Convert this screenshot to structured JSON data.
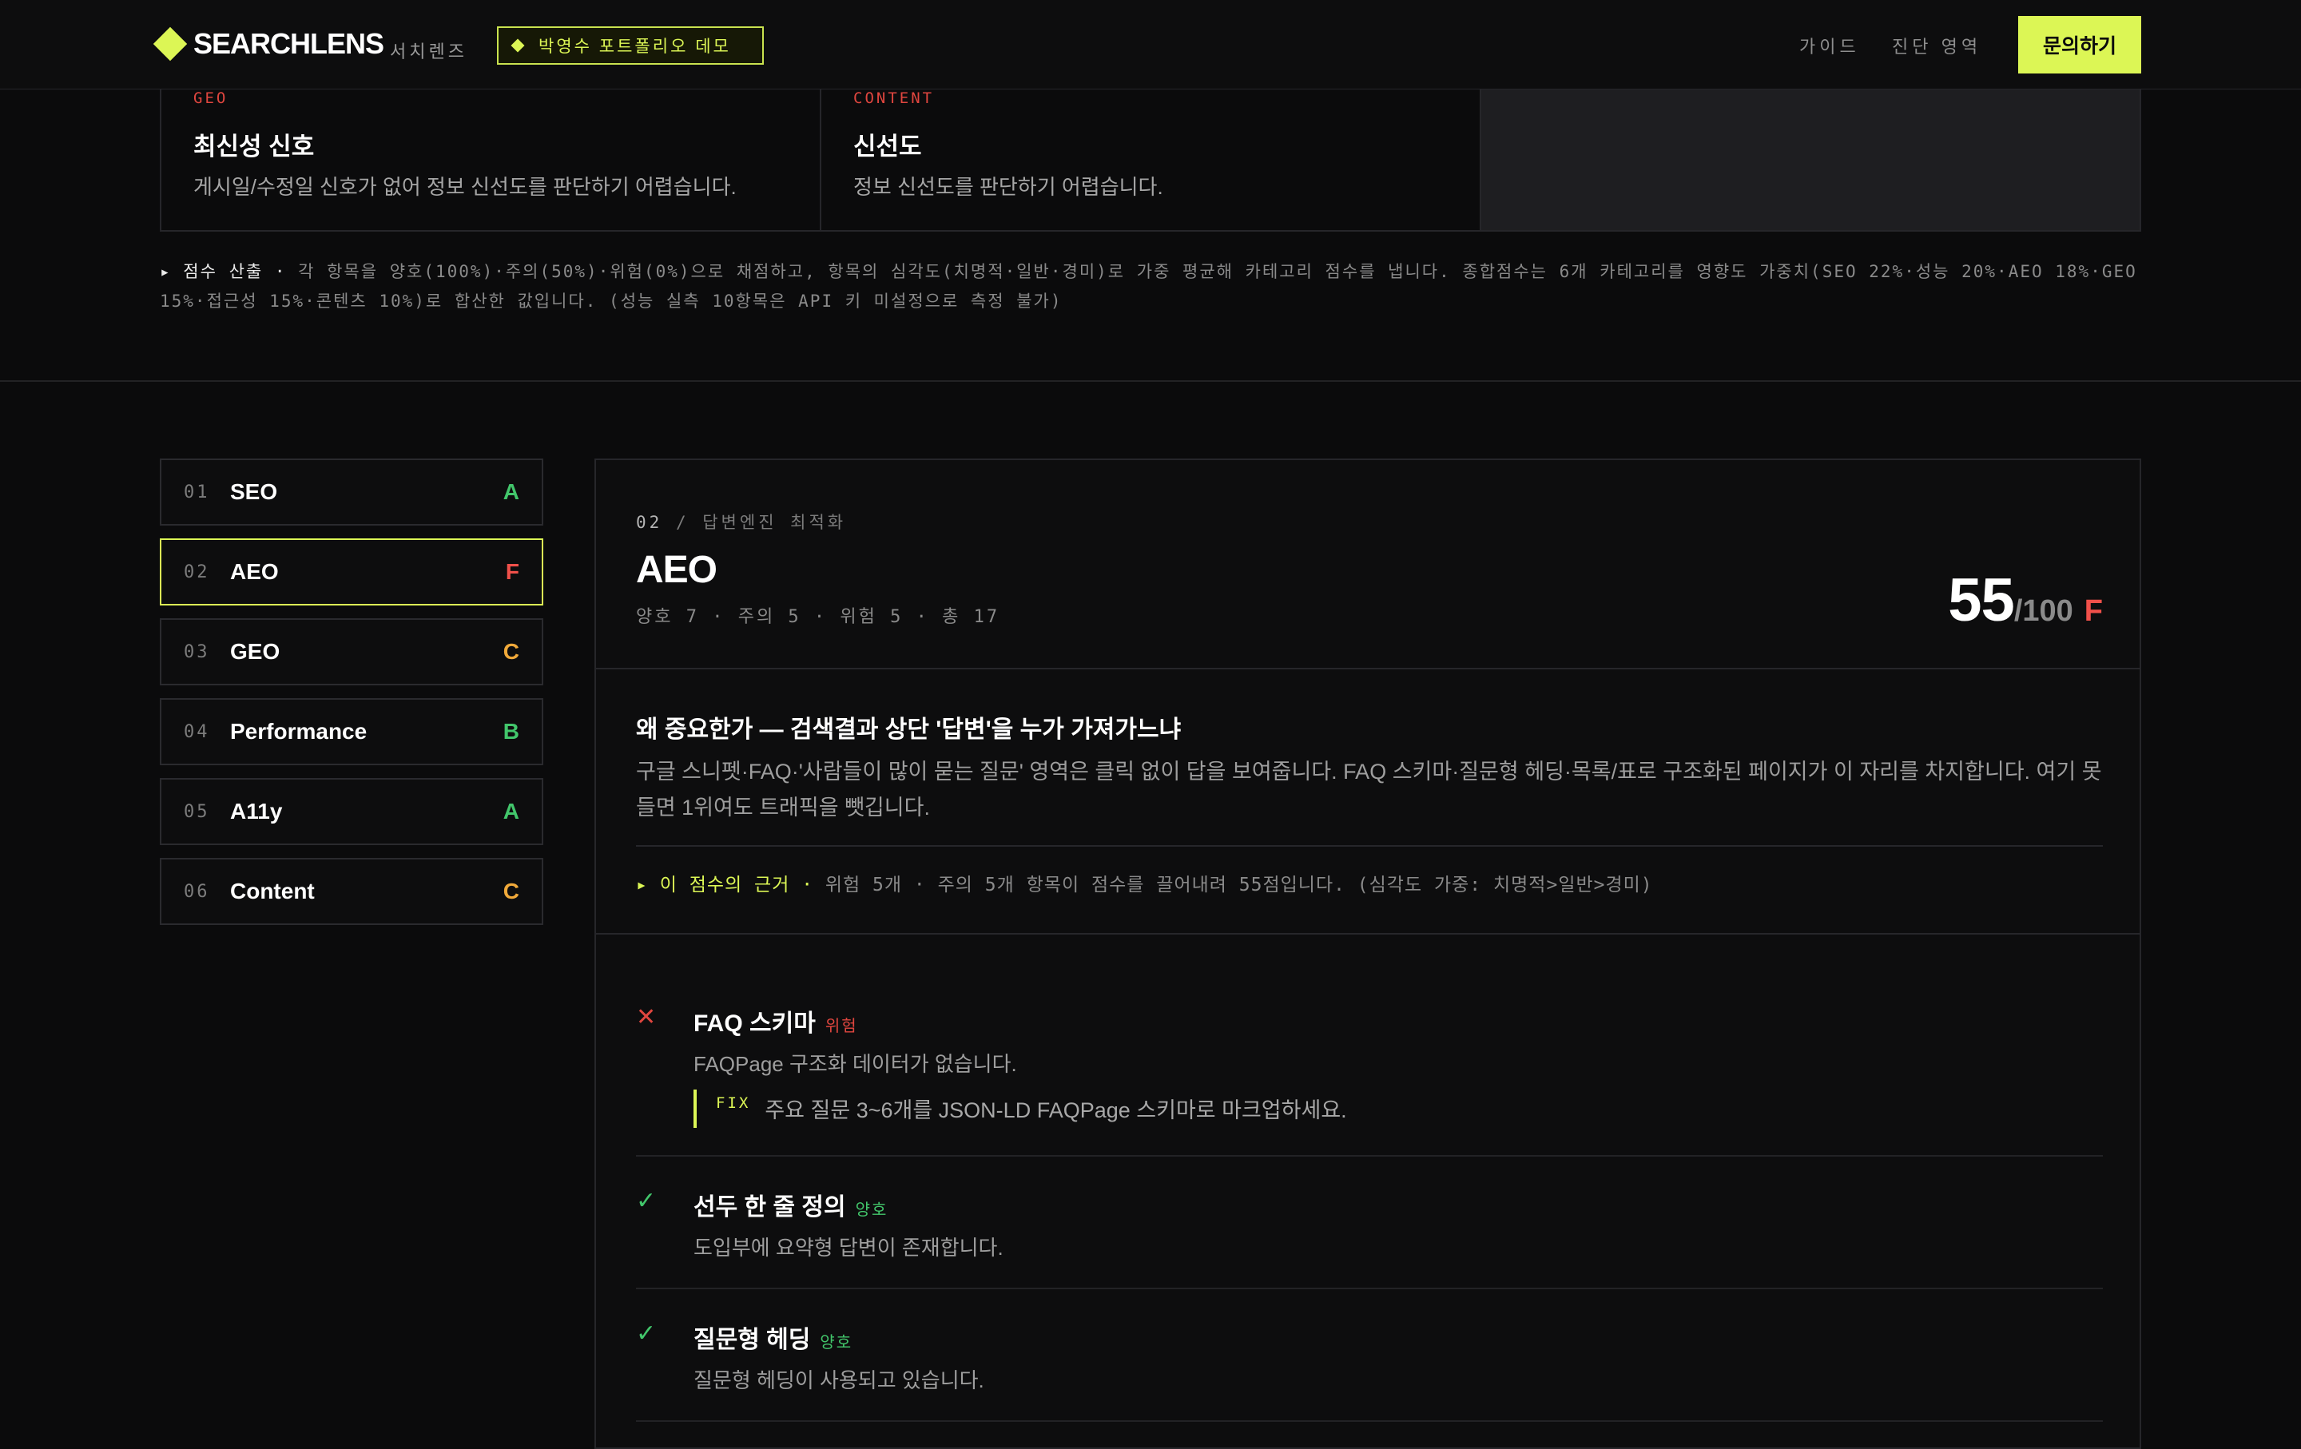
{
  "header": {
    "brand": "SEARCHLENS",
    "brand_sub": "서치렌즈",
    "demo_badge": "박영수 포트폴리오 데모",
    "nav": [
      "가이드",
      "진단 영역"
    ],
    "cta": "문의하기"
  },
  "top_cards": [
    {
      "tag": "GEO",
      "title": "최신성 신호",
      "desc": "게시일/수정일 신호가 없어 정보 신선도를 판단하기 어렵습니다."
    },
    {
      "tag": "CONTENT",
      "title": "신선도",
      "desc": "정보 신선도를 판단하기 어렵습니다."
    }
  ],
  "scoring_note": {
    "label": "▸ 점수 산출 ·",
    "text": " 각 항목을 양호(100%)·주의(50%)·위험(0%)으로 채점하고, 항목의 심각도(치명적·일반·경미)로 가중 평균해 카테고리 점수를 냅니다. 종합점수는 6개 카테고리를 영향도 가중치(SEO 22%·성능 20%·AEO 18%·GEO 15%·접근성 15%·콘텐츠 10%)로 합산한 값입니다. (성능 실측 10항목은 API 키 미설정으로 측정 불가)"
  },
  "sidebar": [
    {
      "num": "01",
      "label": "SEO",
      "grade": "A",
      "color": "#42c66b"
    },
    {
      "num": "02",
      "label": "AEO",
      "grade": "F",
      "color": "#f0504a"
    },
    {
      "num": "03",
      "label": "GEO",
      "grade": "C",
      "color": "#f0a93a"
    },
    {
      "num": "04",
      "label": "Performance",
      "grade": "B",
      "color": "#42c66b"
    },
    {
      "num": "05",
      "label": "A11y",
      "grade": "A",
      "color": "#42c66b"
    },
    {
      "num": "06",
      "label": "Content",
      "grade": "C",
      "color": "#f0a93a"
    }
  ],
  "panel": {
    "crumb_num": "02",
    "crumb_sep": " / ",
    "crumb_label": "답변엔진 최적화",
    "title": "AEO",
    "counts": "양호 7 · 주의 5 · 위험 5 · 총 17",
    "score": "55",
    "score_den": "/100",
    "grade": "F",
    "why_title": "왜 중요한가 — 검색결과 상단 '답변'을 누가 가져가느냐",
    "why_desc": "구글 스니펫·FAQ·'사람들이 많이 묻는 질문' 영역은 클릭 없이 답을 보여줍니다. FAQ 스키마·질문형 헤딩·목록/표로 구조화된 페이지가 이 자리를 차지합니다. 여기 못 들면 1위여도 트래픽을 뺏깁니다.",
    "basis_label": "▸ 이 점수의 근거 ·",
    "basis_text": " 위험 5개 · 주의 5개 항목이 점수를 끌어내려 55점입니다. (심각도 가중: 치명적>일반>경미)",
    "checks": [
      {
        "mark": "✕",
        "type": "x",
        "name": "FAQ 스키마",
        "status": "위험",
        "status_color": "#e0463f",
        "desc": "FAQPage 구조화 데이터가 없습니다.",
        "fix_label": "FIX",
        "fix_text": "주요 질문 3~6개를 JSON-LD FAQPage 스키마로 마크업하세요."
      },
      {
        "mark": "✓",
        "type": "ok",
        "name": "선두 한 줄 정의",
        "status": "양호",
        "status_color": "#42c66b",
        "desc": "도입부에 요약형 답변이 존재합니다."
      },
      {
        "mark": "✓",
        "type": "ok",
        "name": "질문형 헤딩",
        "status": "양호",
        "status_color": "#42c66b",
        "desc": "질문형 헤딩이 사용되고 있습니다."
      }
    ]
  }
}
